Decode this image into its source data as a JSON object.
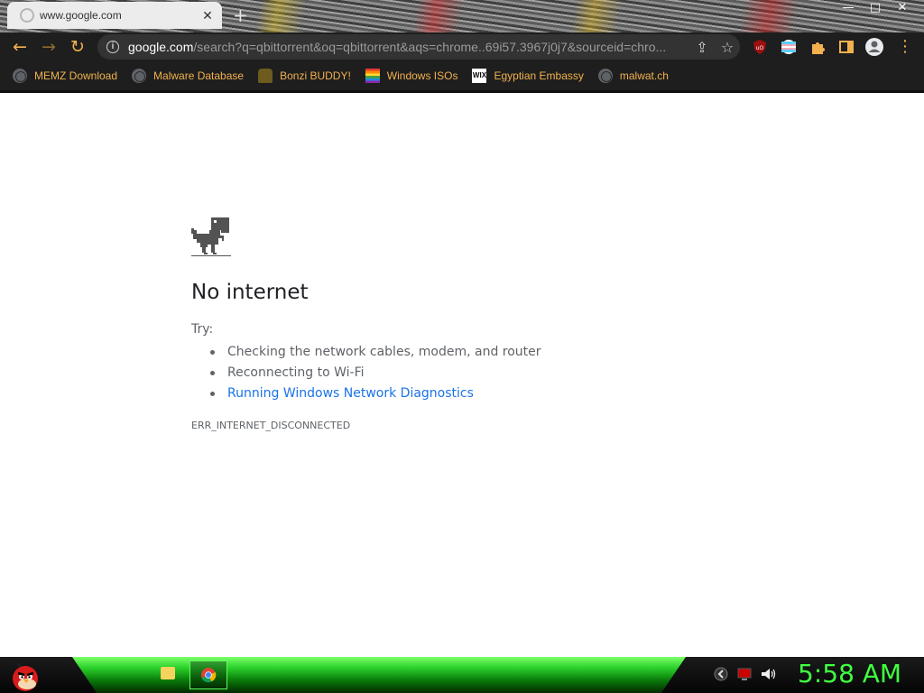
{
  "browser": {
    "tab": {
      "title": "www.google.com",
      "close": "✕"
    },
    "new_tab": "+",
    "window_controls": {
      "minimize": "—",
      "maximize": "□",
      "close": "✕"
    },
    "nav": {
      "back": "←",
      "forward": "→",
      "reload": "↻"
    },
    "omnibox": {
      "host": "google.com",
      "path": "/search?q=qbittorrent&oq=qbittorrent&aqs=chrome..69i57.3967j0j7&sourceid=chro..."
    },
    "menu": "⋮"
  },
  "bookmarks": [
    {
      "label": "MEMZ Download",
      "icon": "globe-icon"
    },
    {
      "label": "Malware Database",
      "icon": "globe-icon"
    },
    {
      "label": "Bonzi BUDDY!",
      "icon": "bonzi-icon"
    },
    {
      "label": "Windows ISOs",
      "icon": "rainbow-flag-icon"
    },
    {
      "label": "Egyptian Embassy",
      "icon": "wix-icon",
      "icon_text": "WIX"
    },
    {
      "label": "malwat.ch",
      "icon": "globe-icon"
    }
  ],
  "page": {
    "heading": "No internet",
    "try_label": "Try:",
    "suggestions": [
      "Checking the network cables, modem, and router",
      "Reconnecting to Wi-Fi",
      "Running Windows Network Diagnostics"
    ],
    "error_code": "ERR_INTERNET_DISCONNECTED"
  },
  "taskbar": {
    "clock": "5:58 AM"
  },
  "colors": {
    "bookmark_text": "#f2b14e",
    "link": "#1a73e8",
    "clock": "#40ff40",
    "toolbar_bg": "#1e1e1e"
  }
}
